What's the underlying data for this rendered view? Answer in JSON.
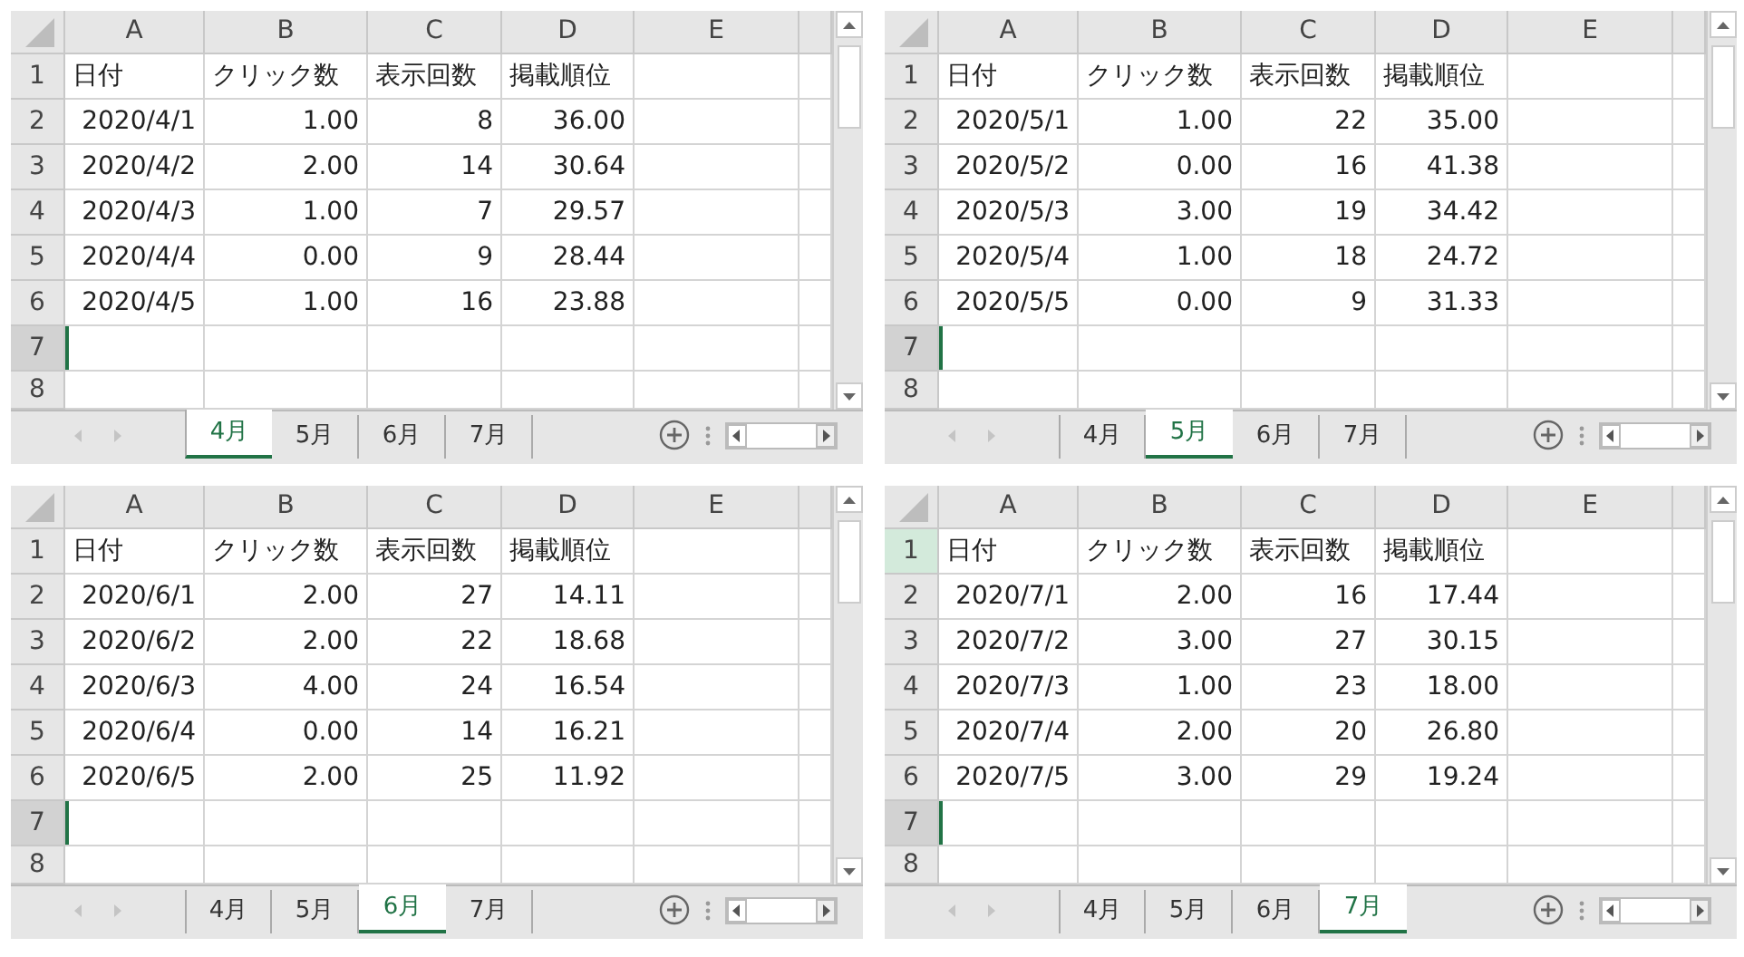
{
  "sheets": [
    {
      "columns": [
        "A",
        "B",
        "C",
        "D",
        "E"
      ],
      "rows": [
        {
          "number": "1",
          "kind": "text",
          "selected": false,
          "highlighted": false,
          "cells": [
            "日付",
            "クリック数",
            "表示回数",
            "掲載順位"
          ]
        },
        {
          "number": "2",
          "kind": "number",
          "selected": false,
          "highlighted": false,
          "cells": [
            "2020/4/1",
            "1.00",
            "8",
            "36.00"
          ]
        },
        {
          "number": "3",
          "kind": "number",
          "selected": false,
          "highlighted": false,
          "cells": [
            "2020/4/2",
            "2.00",
            "14",
            "30.64"
          ]
        },
        {
          "number": "4",
          "kind": "number",
          "selected": false,
          "highlighted": false,
          "cells": [
            "2020/4/3",
            "1.00",
            "7",
            "29.57"
          ]
        },
        {
          "number": "5",
          "kind": "number",
          "selected": false,
          "highlighted": false,
          "cells": [
            "2020/4/4",
            "0.00",
            "9",
            "28.44"
          ]
        },
        {
          "number": "6",
          "kind": "number",
          "selected": false,
          "highlighted": false,
          "cells": [
            "2020/4/5",
            "1.00",
            "16",
            "23.88"
          ]
        },
        {
          "number": "7",
          "kind": "number",
          "selected": true,
          "highlighted": false,
          "cells": []
        },
        {
          "number": "8",
          "kind": "number",
          "selected": false,
          "highlighted": false,
          "cells": []
        }
      ],
      "tabs": [
        {
          "label": "4月",
          "selected": true
        },
        {
          "label": "5月",
          "selected": false
        },
        {
          "label": "6月",
          "selected": false
        },
        {
          "label": "7月",
          "selected": false
        }
      ]
    },
    {
      "columns": [
        "A",
        "B",
        "C",
        "D",
        "E"
      ],
      "rows": [
        {
          "number": "1",
          "kind": "text",
          "selected": false,
          "highlighted": false,
          "cells": [
            "日付",
            "クリック数",
            "表示回数",
            "掲載順位"
          ]
        },
        {
          "number": "2",
          "kind": "number",
          "selected": false,
          "highlighted": false,
          "cells": [
            "2020/5/1",
            "1.00",
            "22",
            "35.00"
          ]
        },
        {
          "number": "3",
          "kind": "number",
          "selected": false,
          "highlighted": false,
          "cells": [
            "2020/5/2",
            "0.00",
            "16",
            "41.38"
          ]
        },
        {
          "number": "4",
          "kind": "number",
          "selected": false,
          "highlighted": false,
          "cells": [
            "2020/5/3",
            "3.00",
            "19",
            "34.42"
          ]
        },
        {
          "number": "5",
          "kind": "number",
          "selected": false,
          "highlighted": false,
          "cells": [
            "2020/5/4",
            "1.00",
            "18",
            "24.72"
          ]
        },
        {
          "number": "6",
          "kind": "number",
          "selected": false,
          "highlighted": false,
          "cells": [
            "2020/5/5",
            "0.00",
            "9",
            "31.33"
          ]
        },
        {
          "number": "7",
          "kind": "number",
          "selected": true,
          "highlighted": false,
          "cells": []
        },
        {
          "number": "8",
          "kind": "number",
          "selected": false,
          "highlighted": false,
          "cells": []
        }
      ],
      "tabs": [
        {
          "label": "4月",
          "selected": false
        },
        {
          "label": "5月",
          "selected": true
        },
        {
          "label": "6月",
          "selected": false
        },
        {
          "label": "7月",
          "selected": false
        }
      ]
    },
    {
      "columns": [
        "A",
        "B",
        "C",
        "D",
        "E"
      ],
      "rows": [
        {
          "number": "1",
          "kind": "text",
          "selected": false,
          "highlighted": false,
          "cells": [
            "日付",
            "クリック数",
            "表示回数",
            "掲載順位"
          ]
        },
        {
          "number": "2",
          "kind": "number",
          "selected": false,
          "highlighted": false,
          "cells": [
            "2020/6/1",
            "2.00",
            "27",
            "14.11"
          ]
        },
        {
          "number": "3",
          "kind": "number",
          "selected": false,
          "highlighted": false,
          "cells": [
            "2020/6/2",
            "2.00",
            "22",
            "18.68"
          ]
        },
        {
          "number": "4",
          "kind": "number",
          "selected": false,
          "highlighted": false,
          "cells": [
            "2020/6/3",
            "4.00",
            "24",
            "16.54"
          ]
        },
        {
          "number": "5",
          "kind": "number",
          "selected": false,
          "highlighted": false,
          "cells": [
            "2020/6/4",
            "0.00",
            "14",
            "16.21"
          ]
        },
        {
          "number": "6",
          "kind": "number",
          "selected": false,
          "highlighted": false,
          "cells": [
            "2020/6/5",
            "2.00",
            "25",
            "11.92"
          ]
        },
        {
          "number": "7",
          "kind": "number",
          "selected": true,
          "highlighted": false,
          "cells": []
        },
        {
          "number": "8",
          "kind": "number",
          "selected": false,
          "highlighted": false,
          "cells": []
        }
      ],
      "tabs": [
        {
          "label": "4月",
          "selected": false
        },
        {
          "label": "5月",
          "selected": false
        },
        {
          "label": "6月",
          "selected": true
        },
        {
          "label": "7月",
          "selected": false
        }
      ]
    },
    {
      "columns": [
        "A",
        "B",
        "C",
        "D",
        "E"
      ],
      "rows": [
        {
          "number": "1",
          "kind": "text",
          "selected": false,
          "highlighted": true,
          "cells": [
            "日付",
            "クリック数",
            "表示回数",
            "掲載順位"
          ]
        },
        {
          "number": "2",
          "kind": "number",
          "selected": false,
          "highlighted": false,
          "cells": [
            "2020/7/1",
            "2.00",
            "16",
            "17.44"
          ]
        },
        {
          "number": "3",
          "kind": "number",
          "selected": false,
          "highlighted": false,
          "cells": [
            "2020/7/2",
            "3.00",
            "27",
            "30.15"
          ]
        },
        {
          "number": "4",
          "kind": "number",
          "selected": false,
          "highlighted": false,
          "cells": [
            "2020/7/3",
            "1.00",
            "23",
            "18.00"
          ]
        },
        {
          "number": "5",
          "kind": "number",
          "selected": false,
          "highlighted": false,
          "cells": [
            "2020/7/4",
            "2.00",
            "20",
            "26.80"
          ]
        },
        {
          "number": "6",
          "kind": "number",
          "selected": false,
          "highlighted": false,
          "cells": [
            "2020/7/5",
            "3.00",
            "29",
            "19.24"
          ]
        },
        {
          "number": "7",
          "kind": "number",
          "selected": true,
          "highlighted": false,
          "cells": []
        },
        {
          "number": "8",
          "kind": "number",
          "selected": false,
          "highlighted": false,
          "cells": []
        }
      ],
      "tabs": [
        {
          "label": "4月",
          "selected": false
        },
        {
          "label": "5月",
          "selected": false
        },
        {
          "label": "6月",
          "selected": false
        },
        {
          "label": "7月",
          "selected": true
        }
      ]
    }
  ]
}
